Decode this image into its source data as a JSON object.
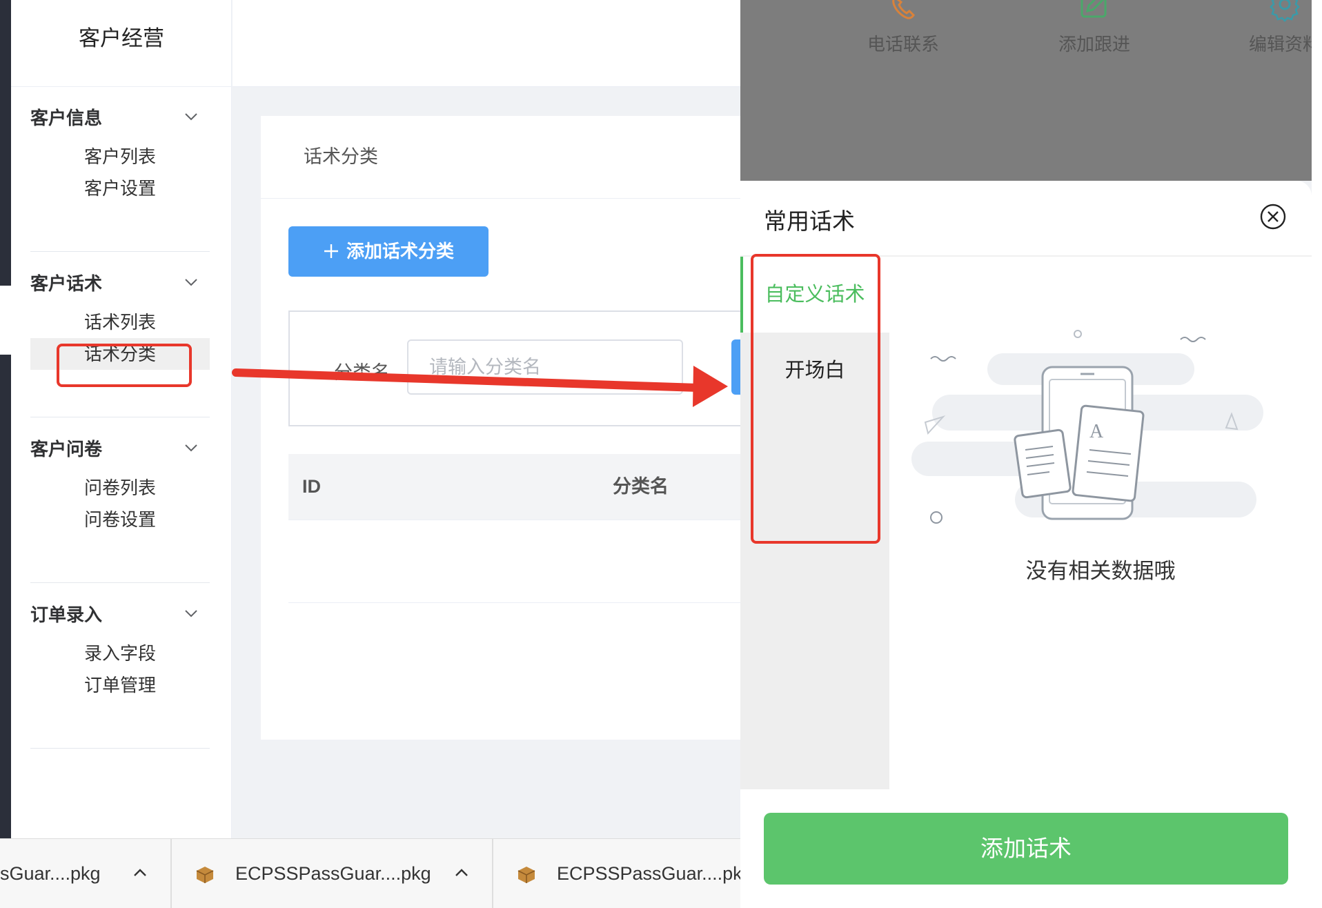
{
  "sidebar": {
    "title": "客户经营",
    "groups": [
      {
        "label": "客户信息",
        "items": [
          "客户列表",
          "客户设置"
        ]
      },
      {
        "label": "客户话术",
        "items": [
          "话术列表",
          "话术分类"
        ]
      },
      {
        "label": "客户问卷",
        "items": [
          "问卷列表",
          "问卷设置"
        ]
      },
      {
        "label": "订单录入",
        "items": [
          "录入字段",
          "订单管理"
        ]
      }
    ],
    "active_item": "话术分类"
  },
  "main": {
    "card_title": "话术分类",
    "add_button": "添加话术分类",
    "add_icon": "plus-icon",
    "filter": {
      "label": "分类名",
      "placeholder": "请输入分类名"
    },
    "table_headers": [
      "ID",
      "分类名"
    ]
  },
  "downloads": [
    {
      "name": "sGuar....pkg"
    },
    {
      "name": "ECPSSPassGuar....pkg"
    },
    {
      "name": "ECPSSPassGuar....pkg"
    }
  ],
  "actions": [
    {
      "label": "电话联系",
      "icon": "phone-icon"
    },
    {
      "label": "添加跟进",
      "icon": "edit-icon"
    },
    {
      "label": "编辑资料",
      "icon": "gear-icon"
    }
  ],
  "sheet": {
    "title": "常用话术",
    "categories": [
      {
        "label": "自定义话术",
        "active": true
      },
      {
        "label": "开场白",
        "active": false
      }
    ],
    "empty_text": "没有相关数据哦",
    "add_button": "添加话术"
  },
  "colors": {
    "accent_blue": "#4c9ff5",
    "accent_green": "#5cc56c",
    "active_green_text": "#4bbd5e",
    "highlight_red": "#e8372b",
    "action_orange": "#d9823a",
    "action_green": "#4aa86a",
    "action_teal": "#3b9aa8"
  }
}
